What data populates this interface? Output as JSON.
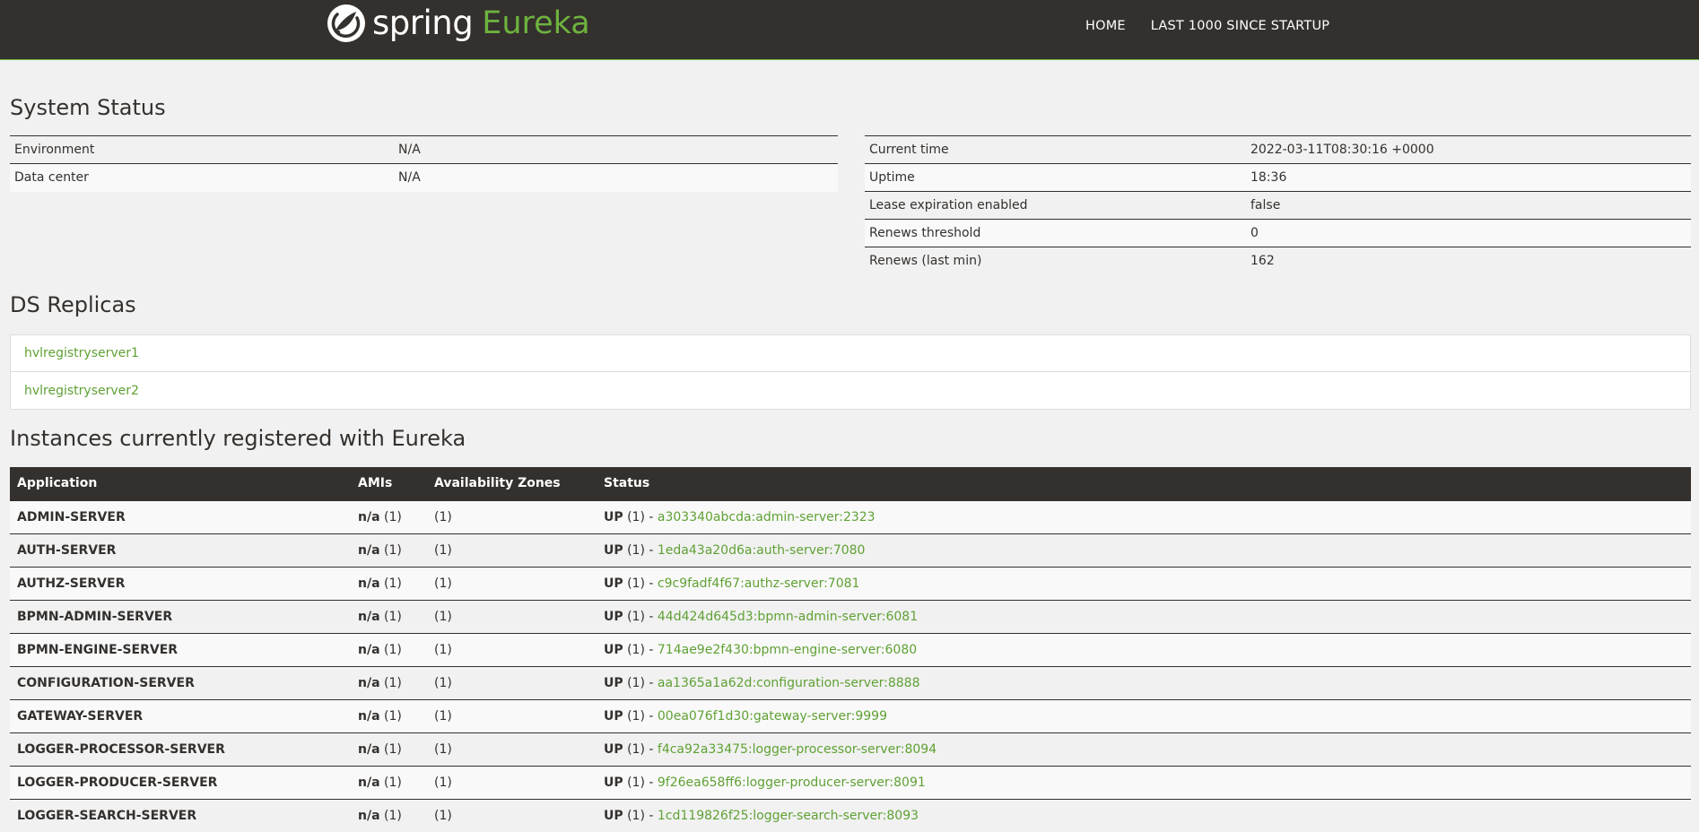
{
  "nav": {
    "brand_spring": "spring",
    "brand_eureka": "Eureka",
    "home": "HOME",
    "last1000": "LAST 1000 SINCE STARTUP"
  },
  "system_status": {
    "title": "System Status",
    "left": [
      {
        "label": "Environment",
        "value": "N/A"
      },
      {
        "label": "Data center",
        "value": "N/A"
      }
    ],
    "right": [
      {
        "label": "Current time",
        "value": "2022-03-11T08:30:16 +0000"
      },
      {
        "label": "Uptime",
        "value": "18:36"
      },
      {
        "label": "Lease expiration enabled",
        "value": "false"
      },
      {
        "label": "Renews threshold",
        "value": "0"
      },
      {
        "label": "Renews (last min)",
        "value": "162"
      }
    ]
  },
  "replicas": {
    "title": "DS Replicas",
    "items": [
      "hvlregistryserver1",
      "hvlregistryserver2"
    ]
  },
  "instances": {
    "title": "Instances currently registered with Eureka",
    "headers": [
      "Application",
      "AMIs",
      "Availability Zones",
      "Status"
    ],
    "rows": [
      {
        "app": "ADMIN-SERVER",
        "ami": "n/a",
        "ami_count": "(1)",
        "zones": "(1)",
        "status": "UP",
        "status_count": "(1) -",
        "instance": "a303340abcda:admin-server:2323"
      },
      {
        "app": "AUTH-SERVER",
        "ami": "n/a",
        "ami_count": "(1)",
        "zones": "(1)",
        "status": "UP",
        "status_count": "(1) -",
        "instance": "1eda43a20d6a:auth-server:7080"
      },
      {
        "app": "AUTHZ-SERVER",
        "ami": "n/a",
        "ami_count": "(1)",
        "zones": "(1)",
        "status": "UP",
        "status_count": "(1) -",
        "instance": "c9c9fadf4f67:authz-server:7081"
      },
      {
        "app": "BPMN-ADMIN-SERVER",
        "ami": "n/a",
        "ami_count": "(1)",
        "zones": "(1)",
        "status": "UP",
        "status_count": "(1) -",
        "instance": "44d424d645d3:bpmn-admin-server:6081"
      },
      {
        "app": "BPMN-ENGINE-SERVER",
        "ami": "n/a",
        "ami_count": "(1)",
        "zones": "(1)",
        "status": "UP",
        "status_count": "(1) -",
        "instance": "714ae9e2f430:bpmn-engine-server:6080"
      },
      {
        "app": "CONFIGURATION-SERVER",
        "ami": "n/a",
        "ami_count": "(1)",
        "zones": "(1)",
        "status": "UP",
        "status_count": "(1) -",
        "instance": "aa1365a1a62d:configuration-server:8888"
      },
      {
        "app": "GATEWAY-SERVER",
        "ami": "n/a",
        "ami_count": "(1)",
        "zones": "(1)",
        "status": "UP",
        "status_count": "(1) -",
        "instance": "00ea076f1d30:gateway-server:9999"
      },
      {
        "app": "LOGGER-PROCESSOR-SERVER",
        "ami": "n/a",
        "ami_count": "(1)",
        "zones": "(1)",
        "status": "UP",
        "status_count": "(1) -",
        "instance": "f4ca92a33475:logger-processor-server:8094"
      },
      {
        "app": "LOGGER-PRODUCER-SERVER",
        "ami": "n/a",
        "ami_count": "(1)",
        "zones": "(1)",
        "status": "UP",
        "status_count": "(1) -",
        "instance": "9f26ea658ff6:logger-producer-server:8091"
      },
      {
        "app": "LOGGER-SEARCH-SERVER",
        "ami": "n/a",
        "ami_count": "(1)",
        "zones": "(1)",
        "status": "UP",
        "status_count": "(1) -",
        "instance": "1cd119826f25:logger-search-server:8093"
      }
    ]
  },
  "colors": {
    "navbar_bg": "#34302d",
    "accent_green": "#6db33f",
    "link_green": "#5fa134",
    "page_bg": "#f1f1f1"
  }
}
